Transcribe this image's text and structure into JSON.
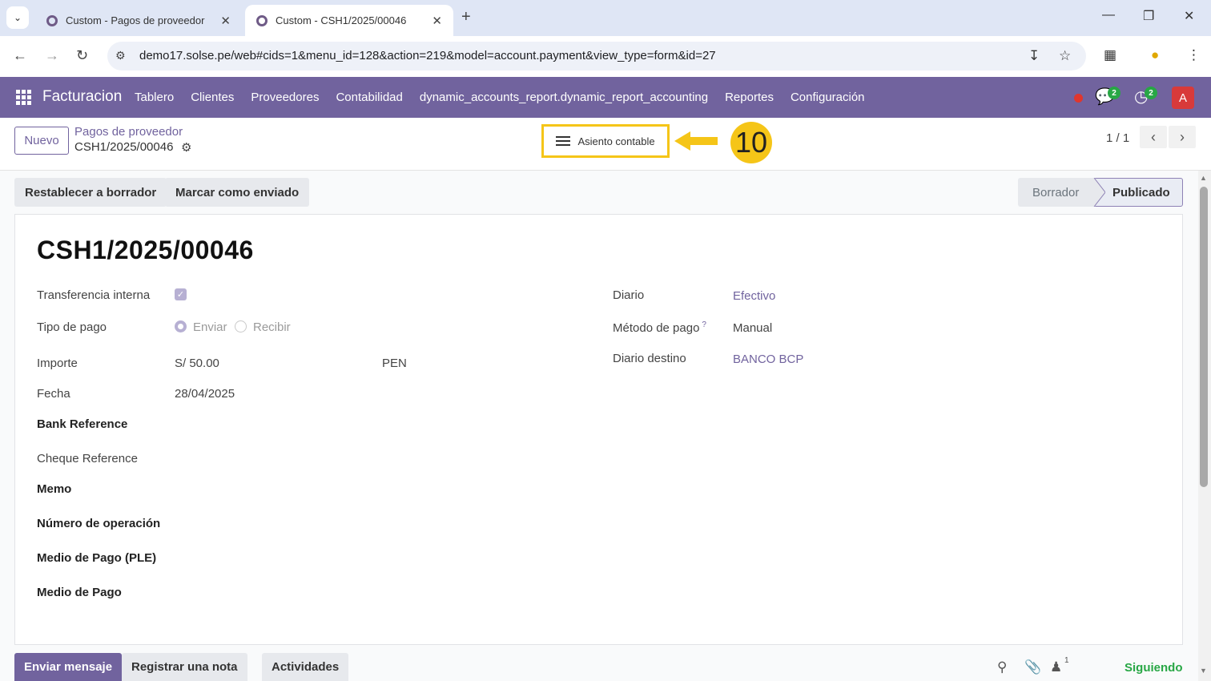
{
  "browser": {
    "tabs": [
      {
        "title": "Custom - Pagos de proveedor",
        "active": false
      },
      {
        "title": "Custom - CSH1/2025/00046",
        "active": true
      }
    ],
    "url": "demo17.solse.pe/web#cids=1&menu_id=128&action=219&model=account.payment&view_type=form&id=27"
  },
  "navbar": {
    "brand": "Facturacion",
    "menu": [
      "Tablero",
      "Clientes",
      "Proveedores",
      "Contabilidad",
      "dynamic_accounts_report.dynamic_report_accounting",
      "Reportes",
      "Configuración"
    ],
    "chat_count": "2",
    "activity_count": "2",
    "avatar_letter": "A"
  },
  "control_panel": {
    "new_label": "Nuevo",
    "breadcrumb": "Pagos de proveedor",
    "record": "CSH1/2025/00046",
    "smart_button": "Asiento contable",
    "step_number": "10",
    "pager": "1 / 1"
  },
  "statusbar": {
    "buttons": [
      "Restablecer a borrador",
      "Marcar como enviado"
    ],
    "stages": [
      "Borrador",
      "Publicado"
    ],
    "current_stage": "Publicado"
  },
  "form": {
    "title": "CSH1/2025/00046",
    "left": {
      "internal_transfer_label": "Transferencia interna",
      "payment_type_label": "Tipo de pago",
      "payment_type_options": [
        "Enviar",
        "Recibir"
      ],
      "amount_label": "Importe",
      "amount_value": "S/ 50.00",
      "currency": "PEN",
      "date_label": "Fecha",
      "date_value": "28/04/2025",
      "bank_ref_label": "Bank Reference",
      "cheque_ref_label": "Cheque Reference",
      "memo_label": "Memo",
      "operation_label": "Número de operación",
      "ple_label": "Medio de Pago (PLE)",
      "medio_label": "Medio de Pago"
    },
    "right": {
      "journal_label": "Diario",
      "journal_value": "Efectivo",
      "method_label": "Método de pago",
      "method_help": "?",
      "method_value": "Manual",
      "dest_label": "Diario destino",
      "dest_value": "BANCO BCP"
    }
  },
  "chatter": {
    "send": "Enviar mensaje",
    "note": "Registrar una nota",
    "activities": "Actividades",
    "followers_count": "1",
    "following": "Siguiendo"
  },
  "colors": {
    "brand": "#71639e",
    "highlight": "#f5c518",
    "success": "#28a745"
  }
}
